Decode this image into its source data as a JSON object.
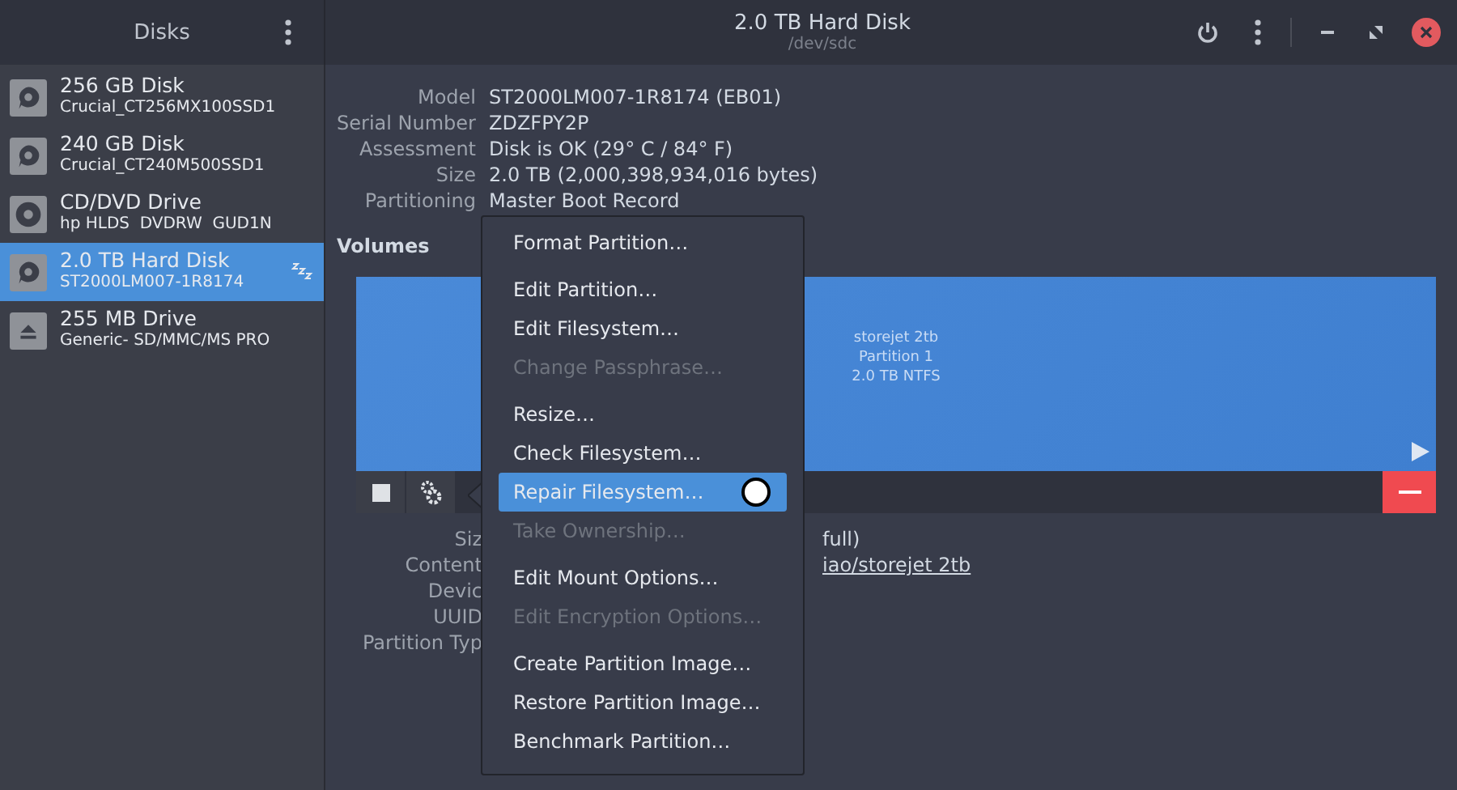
{
  "sidebar": {
    "title": "Disks",
    "items": [
      {
        "kind": "disk",
        "name": "256 GB Disk",
        "model": "Crucial_CT256MX100SSD1",
        "selected": false,
        "sleeping": false
      },
      {
        "kind": "disk",
        "name": "240 GB Disk",
        "model": "Crucial_CT240M500SSD1",
        "selected": false,
        "sleeping": false
      },
      {
        "kind": "optical",
        "name": "CD/DVD Drive",
        "model": "hp HLDS  DVDRW  GUD1N",
        "selected": false,
        "sleeping": false
      },
      {
        "kind": "disk",
        "name": "2.0 TB Hard Disk",
        "model": "ST2000LM007-1R8174",
        "selected": true,
        "sleeping": true
      },
      {
        "kind": "removable",
        "name": "255 MB Drive",
        "model": "Generic- SD/MMC/MS PRO",
        "selected": false,
        "sleeping": false
      }
    ]
  },
  "window": {
    "title": "2.0 TB Hard Disk",
    "subtitle": "/dev/sdc"
  },
  "details": [
    {
      "label": "Model",
      "value": "ST2000LM007-1R8174 (EB01)"
    },
    {
      "label": "Serial Number",
      "value": "ZDZFPY2P"
    },
    {
      "label": "Assessment",
      "value": "Disk is OK (29° C / 84° F)"
    },
    {
      "label": "Size",
      "value": "2.0 TB (2,000,398,934,016 bytes)"
    },
    {
      "label": "Partitioning",
      "value": "Master Boot Record"
    }
  ],
  "volumes": {
    "title": "Volumes",
    "partitions": [
      {
        "lines": [
          "storejet 2tb",
          "Partition 1",
          "2.0 TB NTFS"
        ]
      }
    ]
  },
  "partition_details": [
    {
      "label": "Siz",
      "value": "full)",
      "kind": "text"
    },
    {
      "label": "Content",
      "value": "iao/storejet 2tb",
      "kind": "link"
    },
    {
      "label": "Devic"
    },
    {
      "label": "UUID"
    },
    {
      "label": "Partition Typ"
    }
  ],
  "menu": [
    [
      {
        "label": "Format Partition…",
        "disabled": false,
        "selected": false
      }
    ],
    [
      {
        "label": "Edit Partition…",
        "disabled": false,
        "selected": false
      },
      {
        "label": "Edit Filesystem…",
        "disabled": false,
        "selected": false
      },
      {
        "label": "Change Passphrase…",
        "disabled": true,
        "selected": false
      }
    ],
    [
      {
        "label": "Resize…",
        "disabled": false,
        "selected": false
      },
      {
        "label": "Check Filesystem…",
        "disabled": false,
        "selected": false
      },
      {
        "label": "Repair Filesystem…",
        "disabled": false,
        "selected": true
      },
      {
        "label": "Take Ownership…",
        "disabled": true,
        "selected": false
      }
    ],
    [
      {
        "label": "Edit Mount Options…",
        "disabled": false,
        "selected": false
      },
      {
        "label": "Edit Encryption Options…",
        "disabled": true,
        "selected": false
      }
    ],
    [
      {
        "label": "Create Partition Image…",
        "disabled": false,
        "selected": false
      },
      {
        "label": "Restore Partition Image…",
        "disabled": false,
        "selected": false
      },
      {
        "label": "Benchmark Partition…",
        "disabled": false,
        "selected": false
      }
    ]
  ]
}
